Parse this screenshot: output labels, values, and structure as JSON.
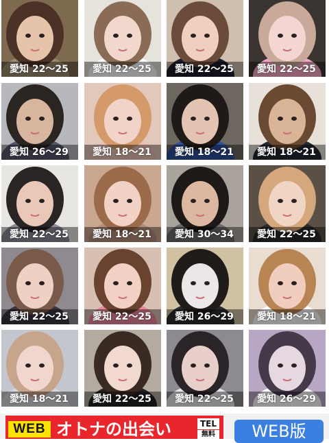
{
  "profiles": [
    {
      "label": "愛知 22〜25",
      "bg": "#7d6a4f",
      "skin": "#e6c4aa",
      "hair": "#4a3326",
      "shirt": "#9a8b6f"
    },
    {
      "label": "愛知 22〜25",
      "bg": "#e6e2dc",
      "skin": "#f1d7cc",
      "hair": "#8a6b55",
      "shirt": "#ffffff"
    },
    {
      "label": "愛知 22〜25",
      "bg": "#cfbfae",
      "skin": "#f0cfbe",
      "hair": "#6b4b3a",
      "shirt": "#1c1c2a"
    },
    {
      "label": "愛知 22〜25",
      "bg": "#3a3530",
      "skin": "#f3d6d2",
      "hair": "#c9a99a",
      "shirt": "#f4a7c6"
    },
    {
      "label": "愛知 26〜29",
      "bg": "#b7b8bd",
      "skin": "#d8b59f",
      "hair": "#2b2522",
      "shirt": "#55566a"
    },
    {
      "label": "愛知 18〜21",
      "bg": "#e2c8ba",
      "skin": "#f2d3c8",
      "hair": "#d49a6a",
      "shirt": "#e8c1b5"
    },
    {
      "label": "愛知 18〜21",
      "bg": "#6d6760",
      "skin": "#e3c3b1",
      "hair": "#1f1a18",
      "shirt": "#2f4f9a"
    },
    {
      "label": "愛知 18〜21",
      "bg": "#e7e1da",
      "skin": "#d9b496",
      "hair": "#6a4a33",
      "shirt": "#232733"
    },
    {
      "label": "愛知 22〜25",
      "bg": "#e8e6e3",
      "skin": "#e9c8b8",
      "hair": "#2a2425",
      "shirt": "#8c8a98"
    },
    {
      "label": "愛知 18〜21",
      "bg": "#caa790",
      "skin": "#f1d2c5",
      "hair": "#9c6b4c",
      "shirt": "#b58e7a"
    },
    {
      "label": "愛知 30〜34",
      "bg": "#a9a39c",
      "skin": "#dcb7a1",
      "hair": "#1d1917",
      "shirt": "#6b6b6b"
    },
    {
      "label": "愛知 22〜25",
      "bg": "#5a5046",
      "skin": "#f1d5c4",
      "hair": "#d4a77c",
      "shirt": "#2c2a2a"
    },
    {
      "label": "愛知 22〜25",
      "bg": "#8f8a90",
      "skin": "#efd1c3",
      "hair": "#7a5a4b",
      "shirt": "#3b3440"
    },
    {
      "label": "愛知 22〜25",
      "bg": "#d7bfb1",
      "skin": "#f2d0c3",
      "hair": "#6a4330",
      "shirt": "#e8879c"
    },
    {
      "label": "愛知 26〜29",
      "bg": "#cfc1a2",
      "skin": "#ebe7e8",
      "hair": "#1e1b19",
      "shirt": "#2b2b2b"
    },
    {
      "label": "愛知 18〜21",
      "bg": "#e9dcd0",
      "skin": "#f0cdbc",
      "hair": "#b88453",
      "shirt": "#ffffff"
    },
    {
      "label": "愛知 18〜21",
      "bg": "#c3c6cd",
      "skin": "#f0d6cc",
      "hair": "#c7a58c",
      "shirt": "#d8d6da"
    },
    {
      "label": "愛知 22〜25",
      "bg": "#b3aaa0",
      "skin": "#f2d9cf",
      "hair": "#3a2a24",
      "shirt": "#222222"
    },
    {
      "label": "愛知 22〜25",
      "bg": "#8d8b90",
      "skin": "#e8cfc9",
      "hair": "#2a2428",
      "shirt": "#e9e6ea"
    },
    {
      "label": "愛知 26〜29",
      "bg": "#b8a7c4",
      "skin": "#e5d8e0",
      "hair": "#453a4a",
      "shirt": "#ffffff"
    }
  ],
  "ad": {
    "badge": "WEB",
    "text": "オトナの出会い",
    "tel": "TEL",
    "tel_sub": "無料"
  },
  "web_button": "WEB版"
}
